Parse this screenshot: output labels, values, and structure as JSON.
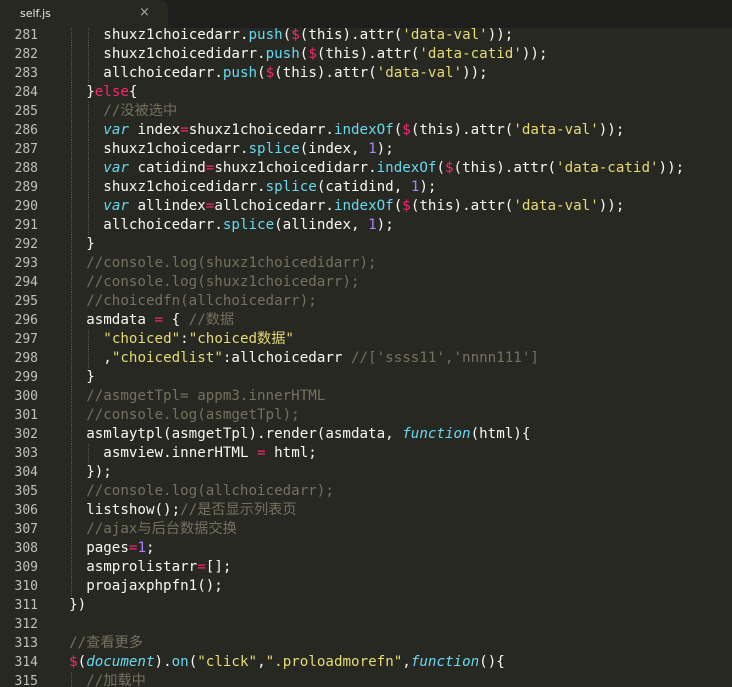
{
  "tab": {
    "title": "self.js",
    "close_glyph": "×"
  },
  "colors": {
    "background": "#272822",
    "plain": "#f8f8f2",
    "keyword": "#f92672",
    "function": "#66d9ef",
    "string": "#e6db74",
    "number": "#ae81ff",
    "comment": "#75715e"
  },
  "lines": [
    {
      "n": "281",
      "lead": "      ",
      "segs": [
        [
          "p",
          "shuxz1choicedarr."
        ],
        [
          "f",
          "push"
        ],
        [
          "p",
          "("
        ],
        [
          "k",
          "$"
        ],
        [
          "p",
          "(this).attr("
        ],
        [
          "s",
          "'data-val'"
        ],
        [
          "p",
          "));"
        ]
      ]
    },
    {
      "n": "282",
      "lead": "      ",
      "segs": [
        [
          "p",
          "shuxz1choicedidarr."
        ],
        [
          "f",
          "push"
        ],
        [
          "p",
          "("
        ],
        [
          "k",
          "$"
        ],
        [
          "p",
          "(this).attr("
        ],
        [
          "s",
          "'data-catid'"
        ],
        [
          "p",
          "));"
        ]
      ]
    },
    {
      "n": "283",
      "lead": "      ",
      "segs": [
        [
          "p",
          "allchoicedarr."
        ],
        [
          "f",
          "push"
        ],
        [
          "p",
          "("
        ],
        [
          "k",
          "$"
        ],
        [
          "p",
          "(this).attr("
        ],
        [
          "s",
          "'data-val'"
        ],
        [
          "p",
          "));"
        ]
      ]
    },
    {
      "n": "284",
      "lead": "    ",
      "segs": [
        [
          "p",
          "}"
        ],
        [
          "k",
          "else"
        ],
        [
          "p",
          "{"
        ]
      ]
    },
    {
      "n": "285",
      "lead": "      ",
      "segs": [
        [
          "c",
          "//没被选中"
        ]
      ]
    },
    {
      "n": "286",
      "lead": "      ",
      "segs": [
        [
          "v",
          "var"
        ],
        [
          "p",
          " index"
        ],
        [
          "k",
          "="
        ],
        [
          "p",
          "shuxz1choicedarr."
        ],
        [
          "f",
          "indexOf"
        ],
        [
          "p",
          "("
        ],
        [
          "k",
          "$"
        ],
        [
          "p",
          "(this).attr("
        ],
        [
          "s",
          "'data-val'"
        ],
        [
          "p",
          "));"
        ]
      ]
    },
    {
      "n": "287",
      "lead": "      ",
      "segs": [
        [
          "p",
          "shuxz1choicedarr."
        ],
        [
          "f",
          "splice"
        ],
        [
          "p",
          "(index, "
        ],
        [
          "n",
          "1"
        ],
        [
          "p",
          ");"
        ]
      ]
    },
    {
      "n": "288",
      "lead": "      ",
      "segs": [
        [
          "v",
          "var"
        ],
        [
          "p",
          " catidind"
        ],
        [
          "k",
          "="
        ],
        [
          "p",
          "shuxz1choicedidarr."
        ],
        [
          "f",
          "indexOf"
        ],
        [
          "p",
          "("
        ],
        [
          "k",
          "$"
        ],
        [
          "p",
          "(this).attr("
        ],
        [
          "s",
          "'data-catid'"
        ],
        [
          "p",
          "));"
        ]
      ]
    },
    {
      "n": "289",
      "lead": "      ",
      "segs": [
        [
          "p",
          "shuxz1choicedidarr."
        ],
        [
          "f",
          "splice"
        ],
        [
          "p",
          "(catidind, "
        ],
        [
          "n",
          "1"
        ],
        [
          "p",
          ");"
        ]
      ]
    },
    {
      "n": "290",
      "lead": "      ",
      "segs": [
        [
          "v",
          "var"
        ],
        [
          "p",
          " allindex"
        ],
        [
          "k",
          "="
        ],
        [
          "p",
          "allchoicedarr."
        ],
        [
          "f",
          "indexOf"
        ],
        [
          "p",
          "("
        ],
        [
          "k",
          "$"
        ],
        [
          "p",
          "(this).attr("
        ],
        [
          "s",
          "'data-val'"
        ],
        [
          "p",
          "));"
        ]
      ]
    },
    {
      "n": "291",
      "lead": "      ",
      "segs": [
        [
          "p",
          "allchoicedarr."
        ],
        [
          "f",
          "splice"
        ],
        [
          "p",
          "(allindex, "
        ],
        [
          "n",
          "1"
        ],
        [
          "p",
          ");"
        ]
      ]
    },
    {
      "n": "292",
      "lead": "    ",
      "segs": [
        [
          "p",
          "}"
        ]
      ]
    },
    {
      "n": "293",
      "lead": "    ",
      "segs": [
        [
          "c",
          "//console.log(shuxz1choicedidarr);"
        ]
      ]
    },
    {
      "n": "294",
      "lead": "    ",
      "segs": [
        [
          "c",
          "//console.log(shuxz1choicedarr);"
        ]
      ]
    },
    {
      "n": "295",
      "lead": "    ",
      "segs": [
        [
          "c",
          "//choicedfn(allchoicedarr);"
        ]
      ]
    },
    {
      "n": "296",
      "lead": "    ",
      "segs": [
        [
          "p",
          "asmdata "
        ],
        [
          "k",
          "="
        ],
        [
          "p",
          " { "
        ],
        [
          "c",
          "//数据"
        ]
      ]
    },
    {
      "n": "297",
      "lead": "      ",
      "segs": [
        [
          "s",
          "\"choiced\""
        ],
        [
          "p",
          ":"
        ],
        [
          "s",
          "\"choiced数据\""
        ]
      ]
    },
    {
      "n": "298",
      "lead": "      ",
      "segs": [
        [
          "p",
          ","
        ],
        [
          "s",
          "\"choicedlist\""
        ],
        [
          "p",
          ":allchoicedarr "
        ],
        [
          "c",
          "//['ssss11','nnnn111']"
        ]
      ]
    },
    {
      "n": "299",
      "lead": "    ",
      "segs": [
        [
          "p",
          "}"
        ]
      ]
    },
    {
      "n": "300",
      "lead": "    ",
      "segs": [
        [
          "c",
          "//asmgetTpl= appm3.innerHTML"
        ]
      ]
    },
    {
      "n": "301",
      "lead": "    ",
      "segs": [
        [
          "c",
          "//console.log(asmgetTpl);"
        ]
      ]
    },
    {
      "n": "302",
      "lead": "    ",
      "segs": [
        [
          "p",
          "asmlaytpl(asmgetTpl).render(asmdata, "
        ],
        [
          "v",
          "function"
        ],
        [
          "p",
          "(html){"
        ]
      ]
    },
    {
      "n": "303",
      "lead": "      ",
      "segs": [
        [
          "p",
          "asmview.innerHTML "
        ],
        [
          "k",
          "="
        ],
        [
          "p",
          " html;"
        ]
      ]
    },
    {
      "n": "304",
      "lead": "    ",
      "segs": [
        [
          "p",
          "});"
        ]
      ]
    },
    {
      "n": "305",
      "lead": "    ",
      "segs": [
        [
          "c",
          "//console.log(allchoicedarr);"
        ]
      ]
    },
    {
      "n": "306",
      "lead": "    ",
      "segs": [
        [
          "p",
          "listshow();"
        ],
        [
          "c",
          "//是否显示列表页"
        ]
      ]
    },
    {
      "n": "307",
      "lead": "    ",
      "segs": [
        [
          "c",
          "//ajax与后台数据交换"
        ]
      ]
    },
    {
      "n": "308",
      "lead": "    ",
      "segs": [
        [
          "p",
          "pages"
        ],
        [
          "k",
          "="
        ],
        [
          "n",
          "1"
        ],
        [
          "p",
          ";"
        ]
      ]
    },
    {
      "n": "309",
      "lead": "    ",
      "segs": [
        [
          "p",
          "asmprolistarr"
        ],
        [
          "k",
          "="
        ],
        [
          "p",
          "[];"
        ]
      ]
    },
    {
      "n": "310",
      "lead": "    ",
      "segs": [
        [
          "p",
          "proajaxphpfn1();"
        ]
      ]
    },
    {
      "n": "311",
      "lead": "  ",
      "segs": [
        [
          "p",
          "})"
        ]
      ]
    },
    {
      "n": "312",
      "lead": "",
      "segs": []
    },
    {
      "n": "313",
      "lead": "  ",
      "segs": [
        [
          "c",
          "//查看更多"
        ]
      ]
    },
    {
      "n": "314",
      "lead": "  ",
      "segs": [
        [
          "k",
          "$"
        ],
        [
          "p",
          "("
        ],
        [
          "v",
          "document"
        ],
        [
          "p",
          ")."
        ],
        [
          "f",
          "on"
        ],
        [
          "p",
          "("
        ],
        [
          "s",
          "\"click\""
        ],
        [
          "p",
          ","
        ],
        [
          "s",
          "\".proloadmorefn\""
        ],
        [
          "p",
          ","
        ],
        [
          "v",
          "function"
        ],
        [
          "p",
          "(){"
        ]
      ]
    },
    {
      "n": "315",
      "lead": "    ",
      "segs": [
        [
          "c",
          "//加载中"
        ]
      ]
    }
  ]
}
